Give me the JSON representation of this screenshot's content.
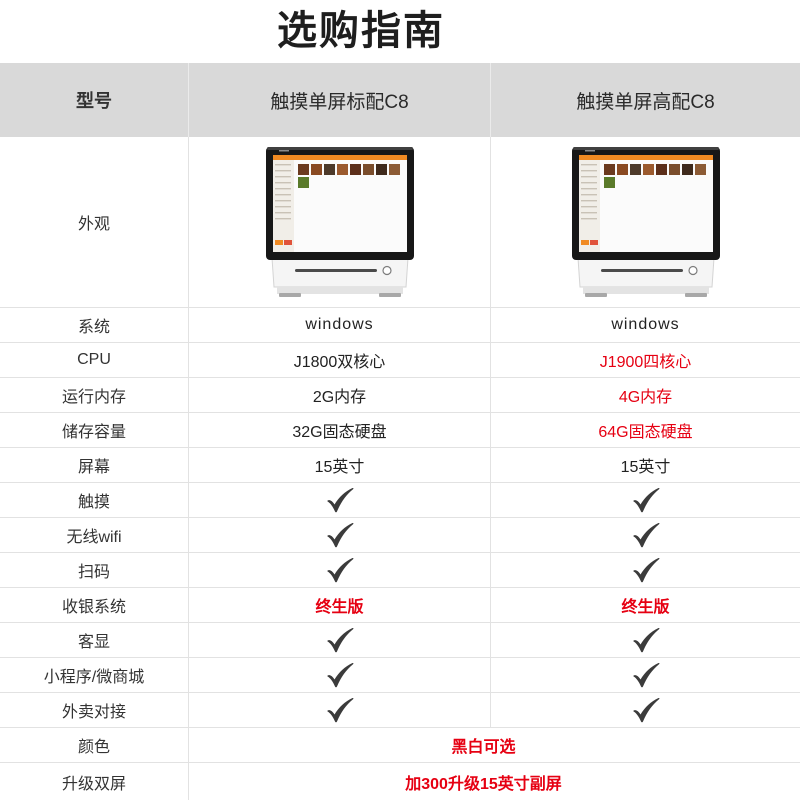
{
  "title": "选购指南",
  "header": {
    "label": "型号",
    "models": [
      "触摸单屏标配C8",
      "触摸单屏高配C8"
    ]
  },
  "appearance": {
    "label": "外观"
  },
  "specs": [
    {
      "label": "系统",
      "values": [
        {
          "text": "windows"
        },
        {
          "text": "windows"
        }
      ]
    },
    {
      "label": "CPU",
      "values": [
        {
          "text": "J1800双核心"
        },
        {
          "text": "J1900四核心",
          "highlight": true
        }
      ]
    },
    {
      "label": "运行内存",
      "values": [
        {
          "text": "2G内存"
        },
        {
          "text": "4G内存",
          "highlight": true
        }
      ]
    },
    {
      "label": "储存容量",
      "values": [
        {
          "text": "32G固态硬盘"
        },
        {
          "text": "64G固态硬盘",
          "highlight": true
        }
      ]
    },
    {
      "label": "屏幕",
      "values": [
        {
          "text": "15英寸"
        },
        {
          "text": "15英寸"
        }
      ]
    },
    {
      "label": "触摸",
      "values": [
        {
          "icon": "checkmark-icon"
        },
        {
          "icon": "checkmark-icon"
        }
      ]
    },
    {
      "label": "无线wifi",
      "values": [
        {
          "icon": "checkmark-icon"
        },
        {
          "icon": "checkmark-icon"
        }
      ]
    },
    {
      "label": "扫码",
      "values": [
        {
          "icon": "checkmark-icon"
        },
        {
          "icon": "checkmark-icon"
        }
      ]
    },
    {
      "label": "收银系统",
      "values": [
        {
          "text": "终生版",
          "highlight": true,
          "bold": true
        },
        {
          "text": "终生版",
          "highlight": true,
          "bold": true
        }
      ]
    },
    {
      "label": "客显",
      "values": [
        {
          "icon": "checkmark-icon"
        },
        {
          "icon": "checkmark-icon"
        }
      ]
    },
    {
      "label": "小程序/微商城",
      "values": [
        {
          "icon": "checkmark-icon"
        },
        {
          "icon": "checkmark-icon"
        }
      ]
    },
    {
      "label": "外卖对接",
      "values": [
        {
          "icon": "checkmark-icon"
        },
        {
          "icon": "checkmark-icon"
        }
      ]
    },
    {
      "label": "颜色",
      "merged": {
        "text": "黑白可选",
        "highlight": true,
        "bold": true
      }
    },
    {
      "label": "升级双屏",
      "merged": {
        "text": "加300升级15英寸副屏",
        "highlight": true,
        "bold": true
      }
    }
  ],
  "colors": {
    "header_bg": "#d9d9d9",
    "highlight": "#e60012",
    "check": "#3b3b3b"
  }
}
